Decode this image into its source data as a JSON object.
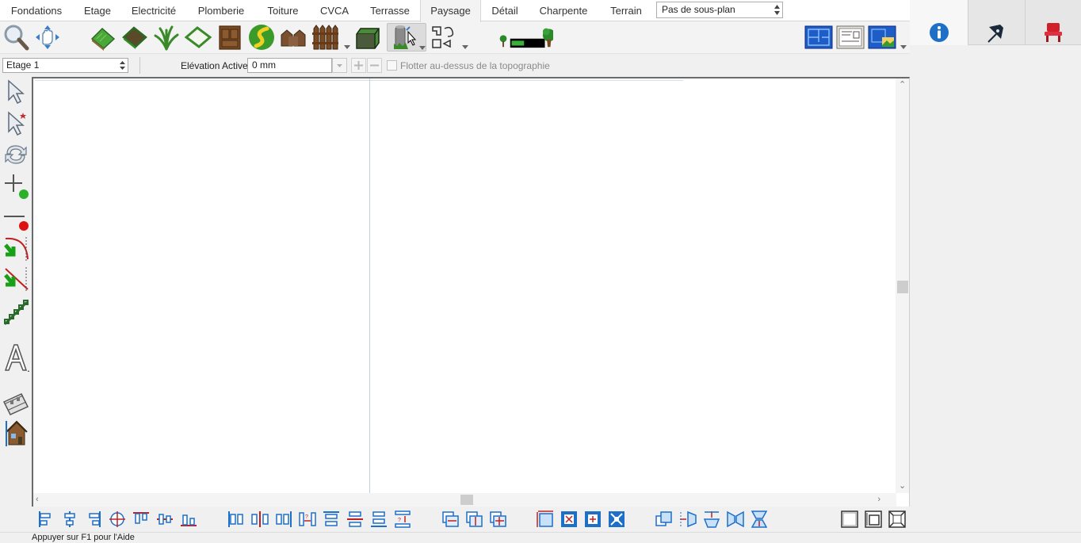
{
  "tabs": [
    {
      "label": "Fondations",
      "active": false
    },
    {
      "label": "Etage",
      "active": false
    },
    {
      "label": "Electricité",
      "active": false
    },
    {
      "label": "Plomberie",
      "active": false
    },
    {
      "label": "Toiture",
      "active": false
    },
    {
      "label": "CVCA",
      "active": false
    },
    {
      "label": "Terrasse",
      "active": false
    },
    {
      "label": "Paysage",
      "active": true
    },
    {
      "label": "Détail",
      "active": false
    },
    {
      "label": "Charpente",
      "active": false
    },
    {
      "label": "Terrain",
      "active": false
    }
  ],
  "subplan": {
    "value": "Pas de sous-plan"
  },
  "floorbar": {
    "floor_value": "Etage 1",
    "elevation_label": "Elévation Active:",
    "elevation_value": "0 mm",
    "float_label": "Flotter au-dessus de la topographie",
    "float_checked": false
  },
  "status": {
    "text": "Appuyer sur F1 pour l'Aide"
  },
  "colors": {
    "accent_blue": "#1e6fc8",
    "landscape_green": "#3a9a2a",
    "chair_red": "#d0202a"
  }
}
